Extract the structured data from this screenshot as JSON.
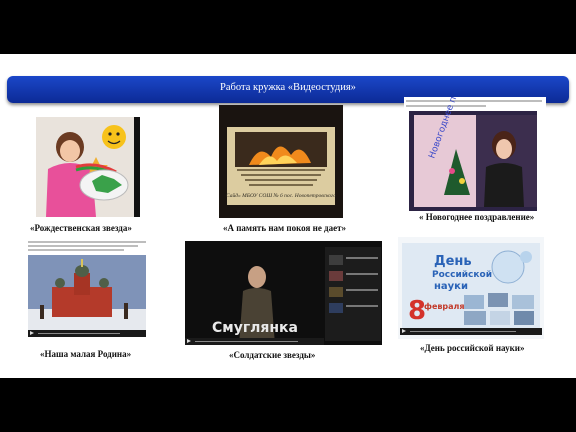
{
  "header": {
    "title": "Работа кружка «Видеостудия»"
  },
  "videos": [
    {
      "caption": "«Рождественская  звезда»"
    },
    {
      "caption": "«А память нам покоя не дает»",
      "overlay_title": "Сайд» МБОУ СОШ № 6 пос. Новопетровского"
    },
    {
      "caption": "« Новогоднее поздравление»",
      "overlay_text": "Новогоднее поздравление"
    },
    {
      "caption": "«Наша малая Родина»"
    },
    {
      "caption": "«Солдатские звезды»",
      "overlay_title": "Смуглянка"
    },
    {
      "caption": "«День российской науки»",
      "poster": {
        "line1": "День",
        "line2": "Российской",
        "line3": "науки",
        "day": "8",
        "month": "февраля"
      }
    }
  ],
  "colors": {
    "banner": "#0c2a95",
    "caption": "#111111",
    "background": "#ffffff"
  }
}
